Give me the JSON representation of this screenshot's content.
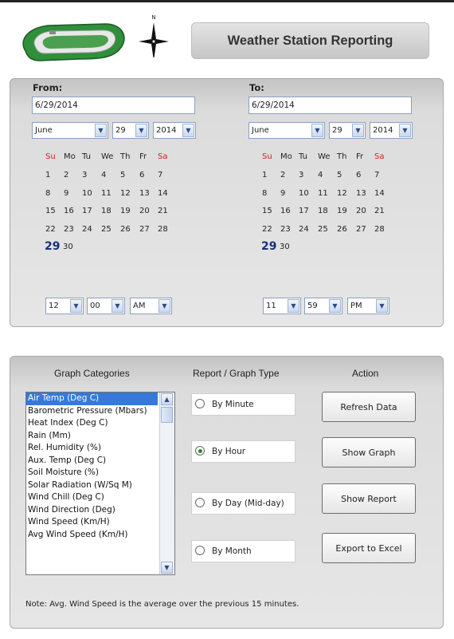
{
  "header": {
    "title": "Weather Station Reporting",
    "compass_letter": "N"
  },
  "from": {
    "label": "From:",
    "date_value": "6/29/2014",
    "month": "June",
    "day": "29",
    "year": "2014",
    "weekdays": [
      "Su",
      "Mo",
      "Tu",
      "We",
      "Th",
      "Fr",
      "Sa"
    ],
    "weeks": [
      [
        "1",
        "2",
        "3",
        "4",
        "5",
        "6",
        "7"
      ],
      [
        "8",
        "9",
        "10",
        "11",
        "12",
        "13",
        "14"
      ],
      [
        "15",
        "16",
        "17",
        "18",
        "19",
        "20",
        "21"
      ],
      [
        "22",
        "23",
        "24",
        "25",
        "26",
        "27",
        "28"
      ],
      [
        "29",
        "30"
      ]
    ],
    "hour": "12",
    "minute": "00",
    "ampm": "AM"
  },
  "to": {
    "label": "To:",
    "date_value": "6/29/2014",
    "month": "June",
    "day": "29",
    "year": "2014",
    "weekdays": [
      "Su",
      "Mo",
      "Tu",
      "We",
      "Th",
      "Fr",
      "Sa"
    ],
    "weeks": [
      [
        "1",
        "2",
        "3",
        "4",
        "5",
        "6",
        "7"
      ],
      [
        "8",
        "9",
        "10",
        "11",
        "12",
        "13",
        "14"
      ],
      [
        "15",
        "16",
        "17",
        "18",
        "19",
        "20",
        "21"
      ],
      [
        "22",
        "23",
        "24",
        "25",
        "26",
        "27",
        "28"
      ],
      [
        "29",
        "30"
      ]
    ],
    "hour": "11",
    "minute": "59",
    "ampm": "PM"
  },
  "graph": {
    "categories_header": "Graph Categories",
    "type_header": "Report / Graph Type",
    "action_header": "Action",
    "categories": [
      "Air Temp (Deg C)",
      "Barometric Pressure (Mbars)",
      "Heat Index (Deg C)",
      "Rain (Mm)",
      "Rel. Humidity (%)",
      "Aux. Temp (Deg C)",
      "Soil Moisture (%)",
      "Solar Radiation (W/Sq M)",
      "Wind Chill (Deg C)",
      "Wind Direction (Deg)",
      "Wind Speed (Km/H)",
      "Avg Wind Speed (Km/H)"
    ],
    "selected_category": "Air Temp (Deg C)",
    "types": [
      {
        "label": "By Minute",
        "checked": false
      },
      {
        "label": "By Hour",
        "checked": true
      },
      {
        "label": "By Day (Mid-day)",
        "checked": false
      },
      {
        "label": "By Month",
        "checked": false
      }
    ],
    "actions": [
      "Refresh Data",
      "Show Graph",
      "Show Report",
      "Export to Excel"
    ]
  },
  "note": "Note: Avg. Wind Speed is the average over the previous 15 minutes.",
  "colors": {
    "weekend": "#d12020",
    "selected_day": "#1a2f7a",
    "list_selection": "#3778d8"
  },
  "icons": {
    "dropdown_arrow": "chevron-down-icon",
    "logo": "racetrack-logo-icon",
    "compass": "compass-icon"
  }
}
